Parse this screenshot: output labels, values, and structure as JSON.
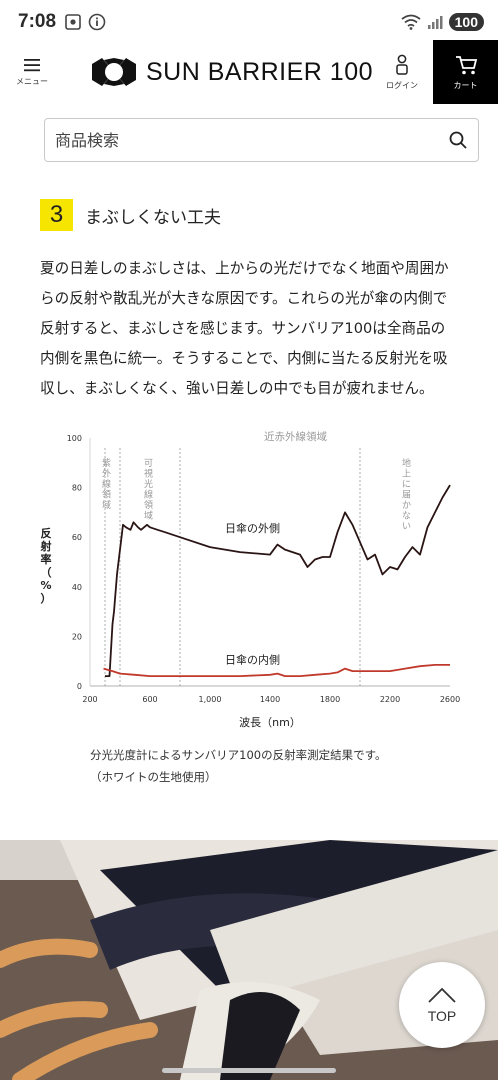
{
  "status_bar": {
    "time": "7:08",
    "battery": "100"
  },
  "header": {
    "menu_label": "メニュー",
    "logo_text": "SUN BARRIER 100",
    "login_label": "ログイン",
    "cart_label": "カート"
  },
  "search": {
    "placeholder": "商品検索"
  },
  "section": {
    "number": "3",
    "title": "まぶしくない工夫",
    "paragraph_lines": [
      "夏の日差しのまぶしさは、上からの光だけでなく地面や周囲か",
      "らの反射や散乱光が大きな原因です。これらの光が傘の内側で",
      "反射すると、まぶしさを感じます。サンバリア100は全商品の",
      "内側を黒色に統一。そうすることで、内側に当たる反射光を吸",
      "収し、まぶしくなく、強い日差しの中でも目が疲れません。"
    ]
  },
  "chart_data": {
    "type": "line",
    "xlabel": "波長（nm）",
    "ylabel": "反射率（%）",
    "xlim": [
      200,
      2600
    ],
    "ylim": [
      0,
      100
    ],
    "x_ticks": [
      "200",
      "600",
      "1,000",
      "1400",
      "1800",
      "2200",
      "2600"
    ],
    "y_ticks": [
      "0",
      "20",
      "40",
      "60",
      "80",
      "100"
    ],
    "region_labels": [
      {
        "text": "紫外線領域",
        "x": 310
      },
      {
        "text": "可視光線領域",
        "x": 590
      },
      {
        "text": "近赤外線領域",
        "x": 1570
      },
      {
        "text": "地上に届かない",
        "x": 2310
      }
    ],
    "region_boundaries": [
      300,
      400,
      800,
      2000
    ],
    "series": [
      {
        "name": "日傘の外側",
        "color": "#2a1414",
        "x": [
          300,
          330,
          350,
          360,
          380,
          400,
          420,
          440,
          470,
          490,
          520,
          540,
          560,
          580,
          600,
          650,
          700,
          800,
          1000,
          1200,
          1400,
          1450,
          1500,
          1600,
          1650,
          1700,
          1750,
          1800,
          1850,
          1900,
          1950,
          2000,
          2050,
          2100,
          2150,
          2200,
          2250,
          2300,
          2350,
          2400,
          2450,
          2500,
          2550,
          2600
        ],
        "y": [
          4,
          4,
          25,
          30,
          45,
          55,
          65,
          64,
          63,
          66,
          64,
          63,
          64,
          65,
          64,
          63,
          62,
          60,
          56,
          54,
          53,
          57,
          55,
          53,
          48,
          51,
          52,
          52,
          62,
          70,
          65,
          58,
          51,
          53,
          45,
          48,
          47,
          52,
          56,
          53,
          64,
          70,
          76,
          81
        ]
      },
      {
        "name": "日傘の内側",
        "color": "#c0392b",
        "x": [
          290,
          350,
          400,
          500,
          600,
          800,
          1000,
          1200,
          1400,
          1450,
          1500,
          1600,
          1700,
          1800,
          1850,
          1900,
          1950,
          2000,
          2100,
          2200,
          2300,
          2400,
          2500,
          2600
        ],
        "y": [
          7,
          6,
          5,
          4.5,
          4,
          4,
          4,
          4,
          4.5,
          5,
          4,
          4,
          4.5,
          5,
          5.5,
          7,
          6,
          6,
          6,
          6,
          7,
          8,
          8.5,
          8.5
        ]
      }
    ]
  },
  "chart_caption": {
    "line1": "分光光度計によるサンバリア100の反射率測定結果です。",
    "line2": "（ホワイトの生地使用）"
  },
  "top_button": {
    "label": "TOP"
  }
}
